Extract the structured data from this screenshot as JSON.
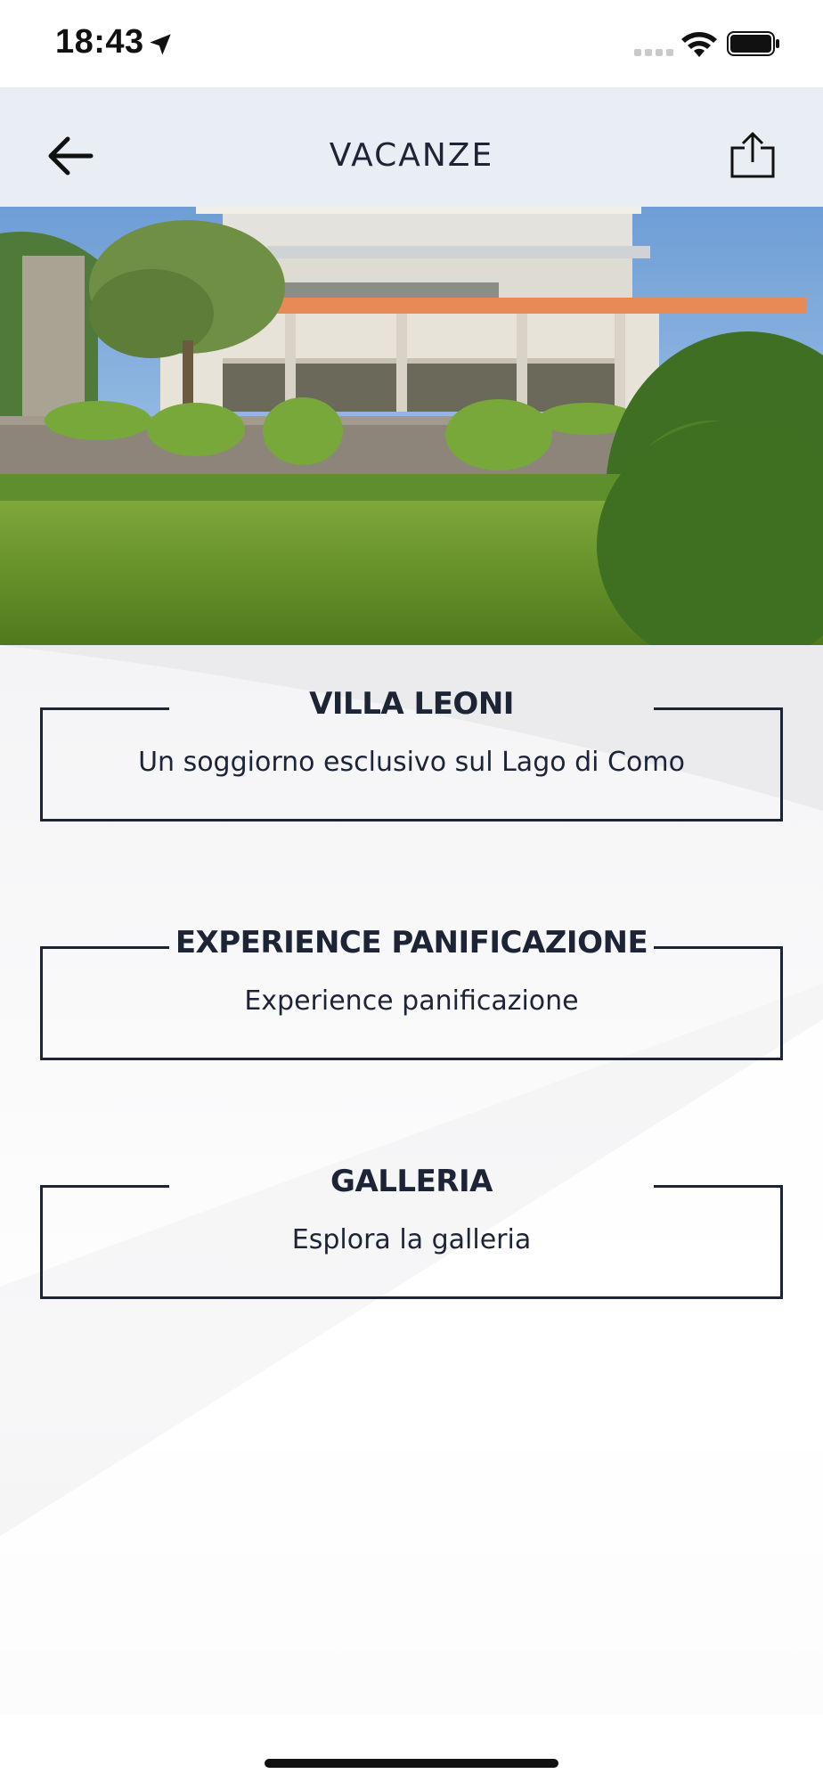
{
  "status_bar": {
    "time": "18:43",
    "icons": [
      "location-arrow-icon",
      "signal-icon",
      "wifi-icon",
      "battery-icon"
    ]
  },
  "nav": {
    "title": "VACANZE",
    "back_icon": "arrow-left-icon",
    "share_icon": "share-icon"
  },
  "hero": {
    "image": "villa-photo"
  },
  "cards": [
    {
      "title": "VILLA LEONI",
      "subtitle": "Un soggiorno esclusivo sul Lago di Como"
    },
    {
      "title": "EXPERIENCE PANIFICAZIONE",
      "subtitle": "Experience panificazione"
    },
    {
      "title": "GALLERIA",
      "subtitle": "Esplora la galleria"
    }
  ],
  "colors": {
    "text": "#1c2435",
    "nav_background": "#e9edf4",
    "accent_beam": "#e88a55"
  }
}
